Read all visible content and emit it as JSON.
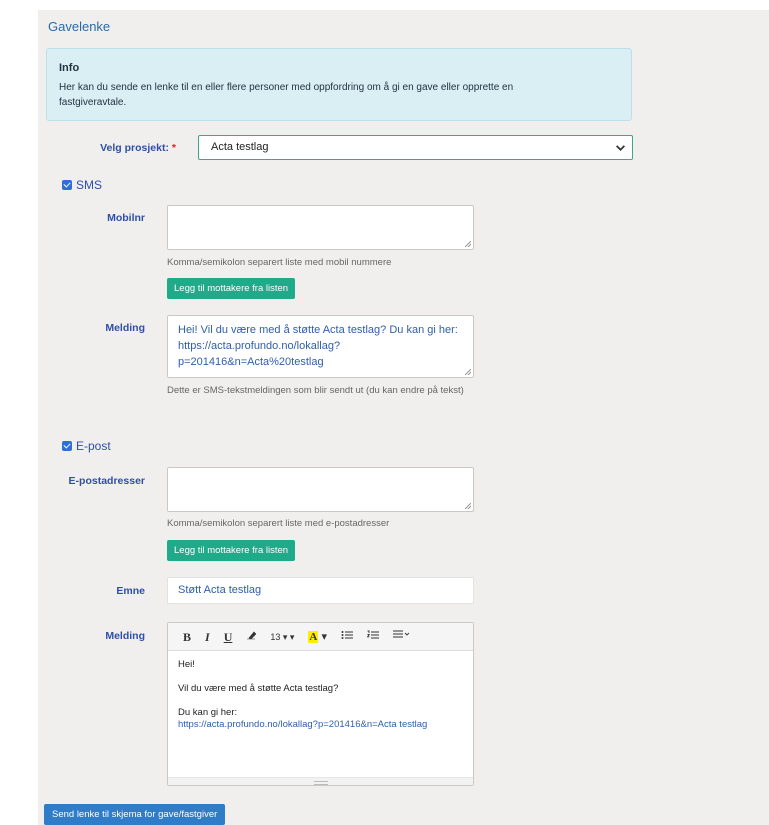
{
  "page": {
    "title": "Gavelenke"
  },
  "info": {
    "title": "Info",
    "text": "Her kan du sende en lenke til en eller flere personer med oppfordring om å gi en gave eller opprette en fastgiveravtale."
  },
  "project": {
    "label": "Velg prosjekt:",
    "required_mark": "*",
    "selected": "Acta testlag"
  },
  "sms": {
    "checkbox_label": "SMS",
    "checked": true,
    "mobile_label": "Mobilnr",
    "mobile_value": "",
    "mobile_help": "Komma/semikolon separert liste med mobil nummere",
    "add_button": "Legg til mottakere fra listen",
    "message_label": "Melding",
    "message_value": "Hei! Vil du være med å støtte Acta testlag? Du kan gi her: https://acta.profundo.no/lokallag?p=201416&n=Acta%20testlag",
    "message_help": "Dette er SMS-tekstmeldingen som blir sendt ut (du kan endre på tekst)"
  },
  "email": {
    "checkbox_label": "E-post",
    "checked": true,
    "address_label": "E-postadresser",
    "address_value": "",
    "address_help": "Komma/semikolon separert liste med e-postadresser",
    "add_button": "Legg til mottakere fra listen",
    "subject_label": "Emne",
    "subject_value": "Støtt Acta testlag",
    "message_label": "Melding",
    "toolbar": {
      "bold": "B",
      "italic": "I",
      "underline": "U",
      "font_size": "13",
      "highlight": "A"
    },
    "body": {
      "greeting": "Hei!",
      "line1": "Vil du være med å støtte Acta testlag?",
      "line2": "Du kan gi her:",
      "link": "https://acta.profundo.no/lokallag?p=201416&n=Acta testlag"
    }
  },
  "submit_button": "Send lenke til skjema for gave/fastgiver",
  "colors": {
    "accent_green": "#1fab89",
    "primary_blue": "#2f7cc9",
    "label_blue": "#2e4fa8",
    "info_bg": "#d9eff3"
  }
}
